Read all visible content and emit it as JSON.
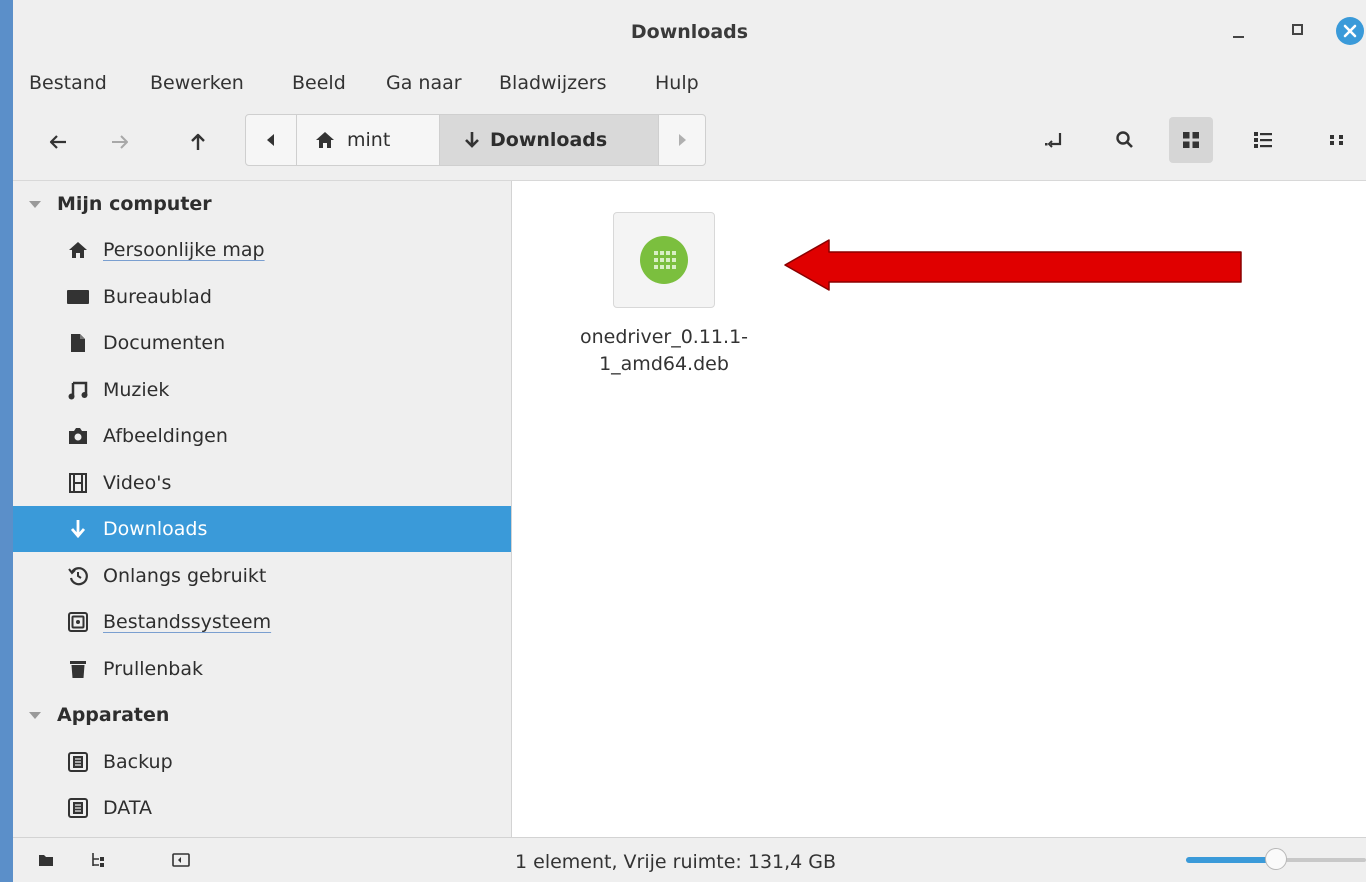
{
  "window": {
    "title": "Downloads"
  },
  "menu": [
    "Bestand",
    "Bewerken",
    "Beeld",
    "Ga naar",
    "Bladwijzers",
    "Hulp"
  ],
  "pathbar": {
    "home": "mint",
    "current": "Downloads"
  },
  "sidebar": {
    "sections": [
      {
        "label": "Mijn computer"
      },
      {
        "label": "Apparaten"
      }
    ],
    "items": [
      {
        "label": "Persoonlijke map",
        "icon": "home-icon"
      },
      {
        "label": "Bureaublad",
        "icon": "desktop-icon"
      },
      {
        "label": "Documenten",
        "icon": "document-icon"
      },
      {
        "label": "Muziek",
        "icon": "music-icon"
      },
      {
        "label": "Afbeeldingen",
        "icon": "camera-icon"
      },
      {
        "label": "Video's",
        "icon": "film-icon"
      },
      {
        "label": "Downloads",
        "icon": "download-icon",
        "selected": true
      },
      {
        "label": "Onlangs gebruikt",
        "icon": "history-icon"
      },
      {
        "label": "Bestandssysteem",
        "icon": "drive-icon"
      },
      {
        "label": "Prullenbak",
        "icon": "trash-icon"
      }
    ],
    "devices": [
      {
        "label": "Backup",
        "icon": "disk-icon"
      },
      {
        "label": "DATA",
        "icon": "disk-icon"
      }
    ]
  },
  "files": [
    {
      "name_line1": "onedriver_0.11.1-",
      "name_line2": "1_amd64.deb",
      "icon": "package-icon"
    }
  ],
  "status": {
    "text": "1 element, Vrije ruimte: 131,4 GB",
    "zoom_fraction": 0.5
  },
  "colors": {
    "accent": "#3a9ad9",
    "annotation_arrow": "#e00000",
    "package": "#7bbf3e"
  }
}
